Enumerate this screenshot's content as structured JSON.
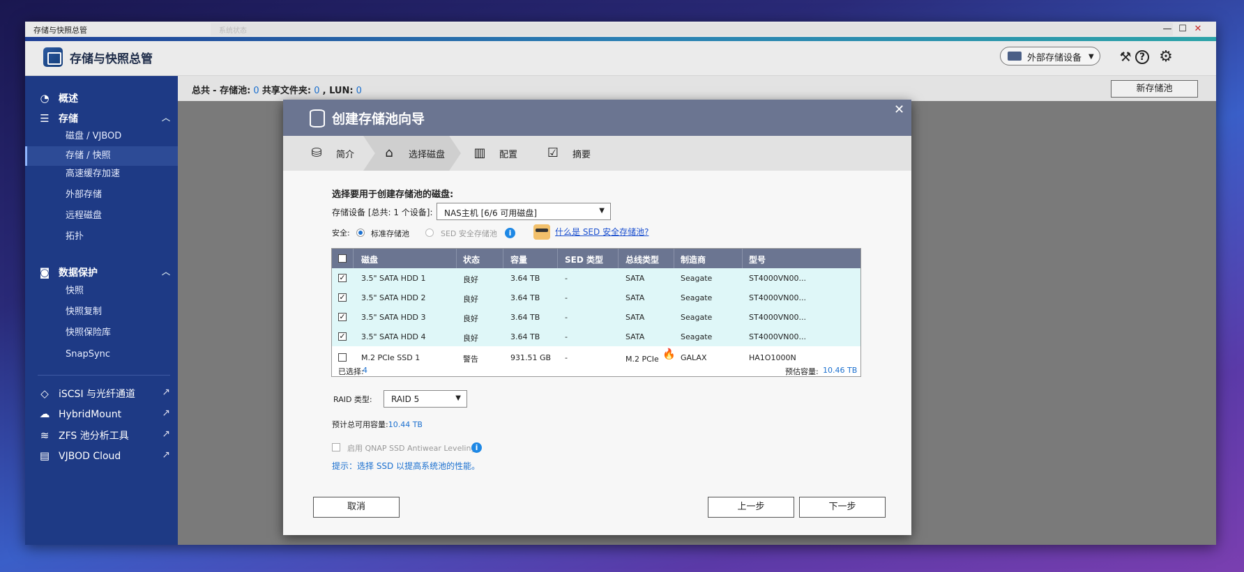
{
  "window": {
    "title": "存储与快照总管",
    "ghost_title": "系统状态",
    "controls": {
      "minimize": "—",
      "maximize": "☐",
      "close": "✕"
    }
  },
  "app": {
    "title": "存储与快照总管",
    "external_device_label": "外部存储设备"
  },
  "sidebar": {
    "overview": "概述",
    "storage": {
      "label": "存储",
      "items": [
        "磁盘 / VJBOD",
        "存储 / 快照",
        "高速缓存加速",
        "外部存储",
        "远程磁盘",
        "拓扑"
      ]
    },
    "data_protection": {
      "label": "数据保护",
      "items": [
        "快照",
        "快照复制",
        "快照保险库",
        "SnapSync"
      ]
    },
    "external_links": [
      "iSCSI 与光纤通道",
      "HybridMount",
      "ZFS 池分析工具",
      "VJBOD Cloud"
    ]
  },
  "mainbar": {
    "total_label": "总共",
    "pool_label": "- 存储池:",
    "pool_count": "0",
    "share_label": "共享文件夹:",
    "share_count": "0",
    "lun_label": ", LUN:",
    "lun_count": "0",
    "new_pool_button": "新存储池"
  },
  "dialog": {
    "title": "创建存储池向导",
    "steps": [
      "简介",
      "选择磁盘",
      "配置",
      "摘要"
    ],
    "select_heading": "选择要用于创建存储池的磁盘:",
    "device_label": "存储设备 [总共: 1 个设备]:",
    "device_value": "NAS主机 [6/6 可用磁盘]",
    "security_label": "安全:",
    "security_options": [
      "标准存储池",
      "SED 安全存储池"
    ],
    "what_is_sed": "什么是 SED 安全存储池?",
    "table": {
      "headers": [
        "磁盘",
        "状态",
        "容量",
        "SED 类型",
        "总线类型",
        "制造商",
        "型号"
      ],
      "rows": [
        {
          "checked": true,
          "disk": "3.5\" SATA HDD 1",
          "status": "良好",
          "capacity": "3.64 TB",
          "sed": "-",
          "bus": "SATA",
          "vendor": "Seagate",
          "model": "ST4000VN00..."
        },
        {
          "checked": true,
          "disk": "3.5\" SATA HDD 2",
          "status": "良好",
          "capacity": "3.64 TB",
          "sed": "-",
          "bus": "SATA",
          "vendor": "Seagate",
          "model": "ST4000VN00..."
        },
        {
          "checked": true,
          "disk": "3.5\" SATA HDD 3",
          "status": "良好",
          "capacity": "3.64 TB",
          "sed": "-",
          "bus": "SATA",
          "vendor": "Seagate",
          "model": "ST4000VN00..."
        },
        {
          "checked": true,
          "disk": "3.5\" SATA HDD 4",
          "status": "良好",
          "capacity": "3.64 TB",
          "sed": "-",
          "bus": "SATA",
          "vendor": "Seagate",
          "model": "ST4000VN00..."
        },
        {
          "checked": false,
          "disk": "M.2 PCIe SSD 1",
          "status": "警告",
          "capacity": "931.51 GB",
          "sed": "-",
          "bus": "M.2 PCIe",
          "vendor": "GALAX",
          "model": "HA1O1000N"
        }
      ],
      "selected_label": "已选择:",
      "selected_count": "4",
      "estimated_label": "预估容量:",
      "estimated_value": "10.46 TB"
    },
    "raid_label": "RAID 类型:",
    "raid_value": "RAID 5",
    "total_usable_label": "预计总可用容量:",
    "total_usable_value": "10.44 TB",
    "antiwear_label": "启用 QNAP SSD Antiwear Leveling",
    "hint": "提示：选择 SSD 以提高系统池的性能。",
    "buttons": {
      "cancel": "取消",
      "prev": "上一步",
      "next": "下一步"
    }
  }
}
